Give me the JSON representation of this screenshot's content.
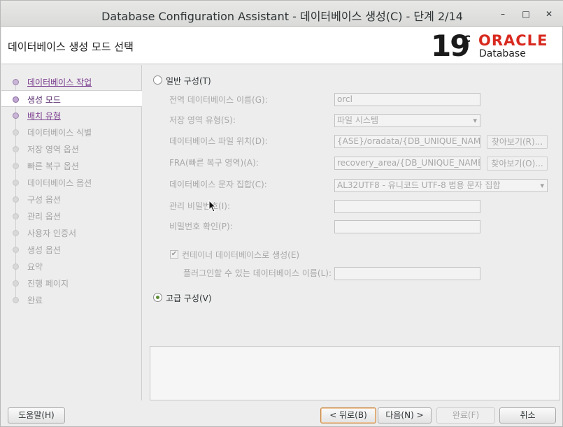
{
  "window": {
    "title": "Database Configuration Assistant - 데이터베이스 생성(C) - 단계 2/14",
    "min_glyph": "–",
    "max_glyph": "□",
    "close_glyph": "✕"
  },
  "header": {
    "page_title": "데이터베이스 생성 모드 선택",
    "logo": {
      "version": "19",
      "version_suffix": "c",
      "brand": "ORACLE",
      "product": "Database"
    }
  },
  "nav": {
    "items": [
      {
        "label": "데이터베이스 작업",
        "state": "done"
      },
      {
        "label": "생성 모드",
        "state": "current"
      },
      {
        "label": "배치 유형",
        "state": "done"
      },
      {
        "label": "데이터베이스 식별",
        "state": "pending"
      },
      {
        "label": "저장 영역 옵션",
        "state": "pending"
      },
      {
        "label": "빠른 복구 옵션",
        "state": "pending"
      },
      {
        "label": "데이터베이스 옵션",
        "state": "pending"
      },
      {
        "label": "구성 옵션",
        "state": "pending"
      },
      {
        "label": "관리 옵션",
        "state": "pending"
      },
      {
        "label": "사용자 인증서",
        "state": "pending"
      },
      {
        "label": "생성 옵션",
        "state": "pending"
      },
      {
        "label": "요약",
        "state": "pending"
      },
      {
        "label": "진행 페이지",
        "state": "pending"
      },
      {
        "label": "완료",
        "state": "pending"
      }
    ]
  },
  "typical": {
    "label": "일반 구성(T)",
    "selected": false,
    "global_db_name": {
      "label": "전역 데이터베이스 이름(G):",
      "value": "orcl"
    },
    "storage_type": {
      "label": "저장 영역 유형(S):",
      "value": "파일 시스템"
    },
    "db_file_location": {
      "label": "데이터베이스 파일 위치(D):",
      "value": "{ASE}/oradata/{DB_UNIQUE_NAME}",
      "browse": "찾아보기(R)..."
    },
    "fra": {
      "label": "FRA(빠른 복구 영역)(A):",
      "value": "recovery_area/{DB_UNIQUE_NAME}",
      "browse": "찾아보기(O)..."
    },
    "charset": {
      "label": "데이터베이스 문자 집합(C):",
      "value": "AL32UTF8 - 유니코드 UTF-8 범용 문자 집합"
    },
    "admin_password": {
      "label": "관리 비밀번호(I):",
      "value": ""
    },
    "confirm_password": {
      "label": "비밀번호 확인(P):",
      "value": ""
    },
    "container": {
      "label": "컨테이너 데이터베이스로 생성(E)",
      "checked": true,
      "check_glyph": "✔"
    },
    "pdb_name": {
      "label": "플러그인할 수 있는 데이터베이스 이름(L):",
      "value": ""
    }
  },
  "advanced": {
    "label": "고급 구성(V)",
    "selected": true
  },
  "buttons": {
    "help": "도움말(H)",
    "back": "< 뒤로(B)",
    "next": "다음(N) >",
    "finish": "완료(F)",
    "cancel": "취소"
  },
  "colors": {
    "accent_purple": "#7a3d8f",
    "oracle_red": "#d8291f",
    "radio_green": "#5d8d33"
  }
}
